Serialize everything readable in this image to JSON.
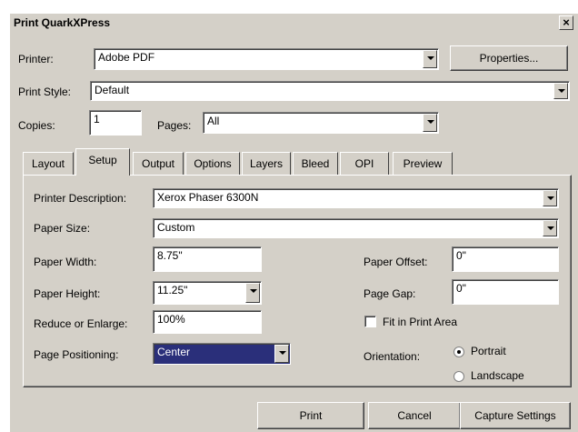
{
  "window": {
    "title": "Print QuarkXPress",
    "close_glyph": "×"
  },
  "printer": {
    "label": "Printer:",
    "value": "Adobe PDF",
    "properties_label": "Properties..."
  },
  "print_style": {
    "label": "Print Style:",
    "value": "Default"
  },
  "copies": {
    "label": "Copies:",
    "value": "1"
  },
  "pages": {
    "label": "Pages:",
    "value": "All"
  },
  "tabs": [
    {
      "label": "Layout"
    },
    {
      "label": "Setup",
      "active": true
    },
    {
      "label": "Output"
    },
    {
      "label": "Options"
    },
    {
      "label": "Layers"
    },
    {
      "label": "Bleed"
    },
    {
      "label": "OPI"
    },
    {
      "label": "Preview"
    }
  ],
  "setup": {
    "printer_description": {
      "label": "Printer Description:",
      "value": "Xerox Phaser 6300N"
    },
    "paper_size": {
      "label": "Paper Size:",
      "value": "Custom"
    },
    "paper_width": {
      "label": "Paper Width:",
      "value": "8.75\""
    },
    "paper_height": {
      "label": "Paper Height:",
      "value": "11.25\""
    },
    "reduce_enlarge": {
      "label": "Reduce or Enlarge:",
      "value": "100%"
    },
    "page_positioning": {
      "label": "Page Positioning:",
      "value": "Center"
    },
    "paper_offset": {
      "label": "Paper Offset:",
      "value": "0\""
    },
    "page_gap": {
      "label": "Page Gap:",
      "value": "0\""
    },
    "fit_in_print_area": {
      "label": "Fit in Print Area",
      "checked": false
    },
    "orientation": {
      "label": "Orientation:",
      "options": [
        {
          "label": "Portrait",
          "selected": true
        },
        {
          "label": "Landscape",
          "selected": false
        }
      ]
    }
  },
  "footer": {
    "print_label": "Print",
    "cancel_label": "Cancel",
    "capture_label": "Capture Settings"
  },
  "colors": {
    "dialog_bg": "#d4d0c8",
    "selection_bg": "#2a2f7a"
  }
}
